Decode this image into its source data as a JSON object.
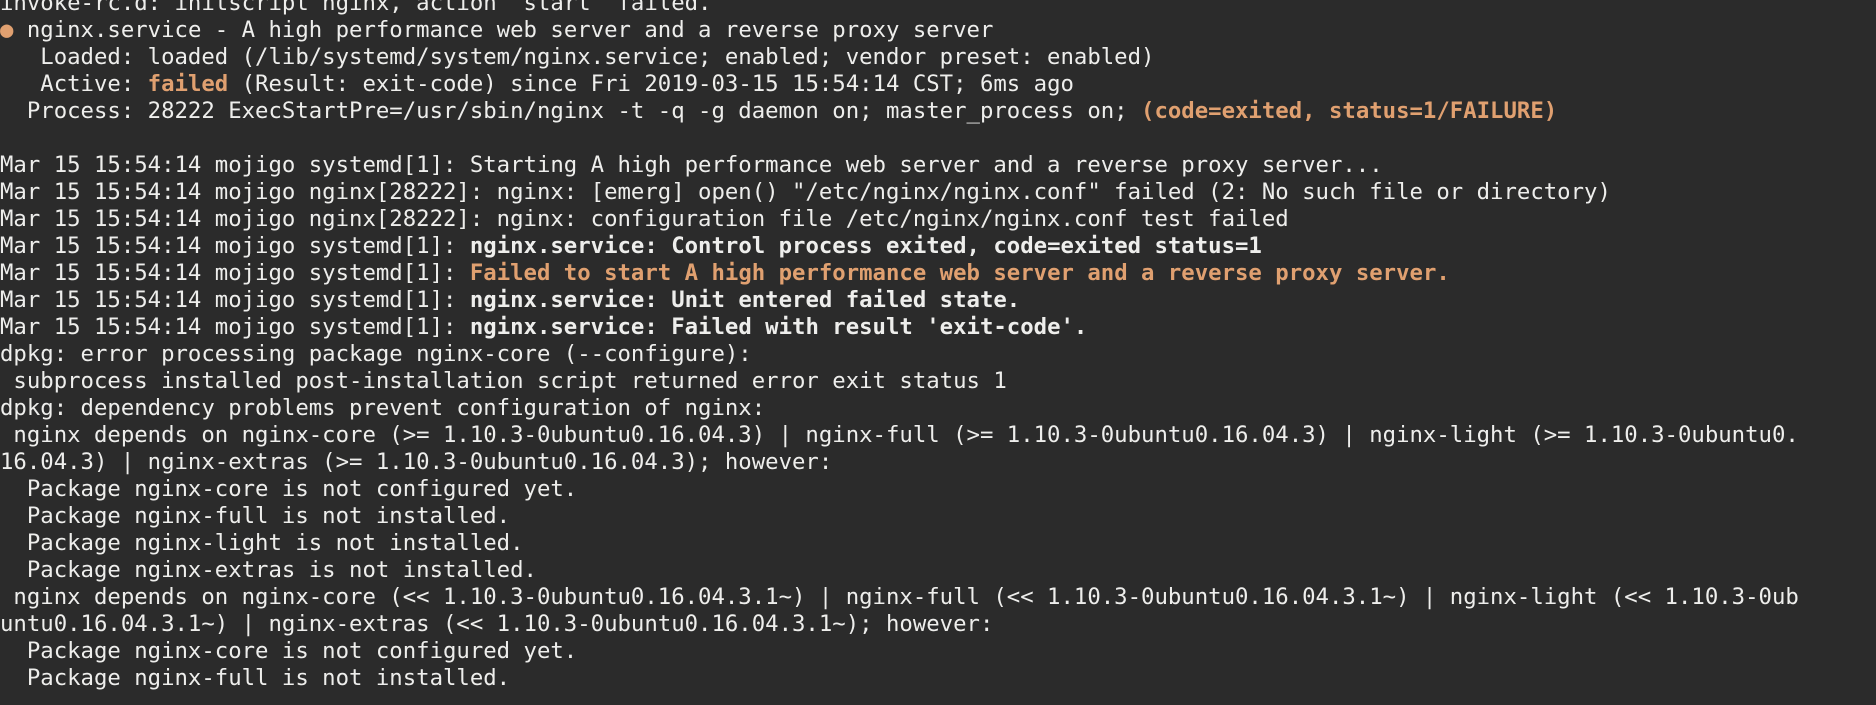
{
  "colors": {
    "background": "#2b2b2b",
    "foreground": "#eeeeec",
    "accent_orange": "#e0a070"
  },
  "lines": [
    [
      {
        "t": "invoke-rc.d: initscript nginx, action \"start\" failed.",
        "s": ""
      }
    ],
    [
      {
        "t": "●",
        "s": "dot"
      },
      {
        "t": " nginx.service - A high performance web server and a reverse proxy server",
        "s": ""
      }
    ],
    [
      {
        "t": "   Loaded: loaded (/lib/systemd/system/nginx.service; enabled; vendor preset: enabled)",
        "s": ""
      }
    ],
    [
      {
        "t": "   Active: ",
        "s": ""
      },
      {
        "t": "failed",
        "s": "orange bold"
      },
      {
        "t": " (Result: exit-code) since Fri 2019-03-15 15:54:14 CST; 6ms ago",
        "s": ""
      }
    ],
    [
      {
        "t": "  Process: 28222 ExecStartPre=/usr/sbin/nginx -t -q -g daemon on; master_process on; ",
        "s": ""
      },
      {
        "t": "(code=exited, status=1/FAILURE)",
        "s": "orange bold"
      }
    ],
    [
      {
        "t": "",
        "s": ""
      }
    ],
    [
      {
        "t": "Mar 15 15:54:14 mojigo systemd[1]: Starting A high performance web server and a reverse proxy server...",
        "s": ""
      }
    ],
    [
      {
        "t": "Mar 15 15:54:14 mojigo nginx[28222]: nginx: [emerg] open() \"/etc/nginx/nginx.conf\" failed (2: No such file or directory)",
        "s": ""
      }
    ],
    [
      {
        "t": "Mar 15 15:54:14 mojigo nginx[28222]: nginx: configuration file /etc/nginx/nginx.conf test failed",
        "s": ""
      }
    ],
    [
      {
        "t": "Mar 15 15:54:14 mojigo systemd[1]: ",
        "s": ""
      },
      {
        "t": "nginx.service: Control process exited, code=exited status=1",
        "s": "bold"
      }
    ],
    [
      {
        "t": "Mar 15 15:54:14 mojigo systemd[1]: ",
        "s": ""
      },
      {
        "t": "Failed to start A high performance web server and a reverse proxy server.",
        "s": "orange bold"
      }
    ],
    [
      {
        "t": "Mar 15 15:54:14 mojigo systemd[1]: ",
        "s": ""
      },
      {
        "t": "nginx.service: Unit entered failed state.",
        "s": "bold"
      }
    ],
    [
      {
        "t": "Mar 15 15:54:14 mojigo systemd[1]: ",
        "s": ""
      },
      {
        "t": "nginx.service: Failed with result 'exit-code'.",
        "s": "bold"
      }
    ],
    [
      {
        "t": "dpkg: error processing package nginx-core (--configure):",
        "s": ""
      }
    ],
    [
      {
        "t": " subprocess installed post-installation script returned error exit status 1",
        "s": ""
      }
    ],
    [
      {
        "t": "dpkg: dependency problems prevent configuration of nginx:",
        "s": ""
      }
    ],
    [
      {
        "t": " nginx depends on nginx-core (>= 1.10.3-0ubuntu0.16.04.3) | nginx-full (>= 1.10.3-0ubuntu0.16.04.3) | nginx-light (>= 1.10.3-0ubuntu0.",
        "s": ""
      }
    ],
    [
      {
        "t": "16.04.3) | nginx-extras (>= 1.10.3-0ubuntu0.16.04.3); however:",
        "s": ""
      }
    ],
    [
      {
        "t": "  Package nginx-core is not configured yet.",
        "s": ""
      }
    ],
    [
      {
        "t": "  Package nginx-full is not installed.",
        "s": ""
      }
    ],
    [
      {
        "t": "  Package nginx-light is not installed.",
        "s": ""
      }
    ],
    [
      {
        "t": "  Package nginx-extras is not installed.",
        "s": ""
      }
    ],
    [
      {
        "t": " nginx depends on nginx-core (<< 1.10.3-0ubuntu0.16.04.3.1~) | nginx-full (<< 1.10.3-0ubuntu0.16.04.3.1~) | nginx-light (<< 1.10.3-0ub",
        "s": ""
      }
    ],
    [
      {
        "t": "untu0.16.04.3.1~) | nginx-extras (<< 1.10.3-0ubuntu0.16.04.3.1~); however:",
        "s": ""
      }
    ],
    [
      {
        "t": "  Package nginx-core is not configured yet.",
        "s": ""
      }
    ],
    [
      {
        "t": "  Package nginx-full is not installed.",
        "s": ""
      }
    ]
  ]
}
